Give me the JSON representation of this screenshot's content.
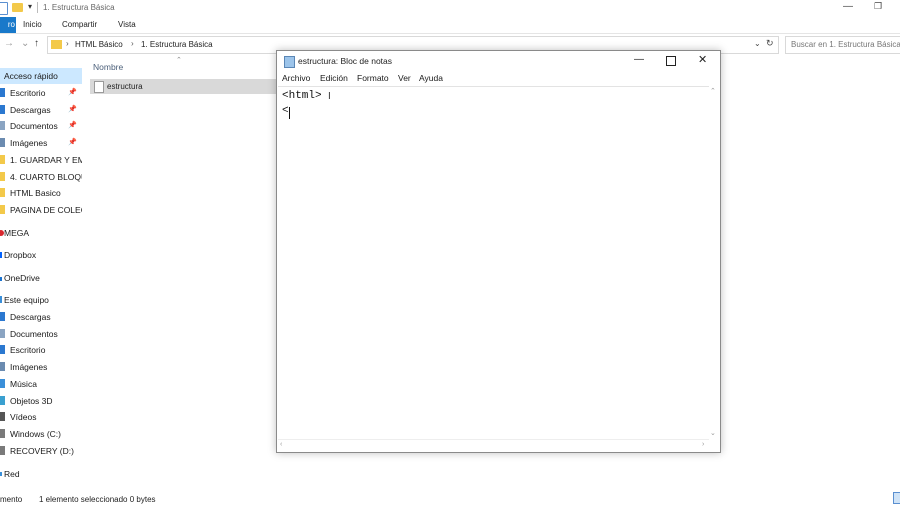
{
  "explorer": {
    "title": "1. Estructura Básica",
    "ribbon_tabs": [
      "ro",
      "Inicio",
      "Compartir",
      "Vista"
    ],
    "breadcrumb": [
      "HTML Básico",
      "1. Estructura Básica"
    ],
    "search_placeholder": "Buscar en 1. Estructura Básica",
    "column_name": "Nombre",
    "files": [
      "estructura"
    ],
    "status": {
      "items": "mento",
      "selected": "1 elemento seleccionado  0 bytes"
    }
  },
  "nav": {
    "quick_access": "Acceso rápido",
    "items": [
      {
        "label": "Escritorio",
        "icon": "desktop-icon",
        "color": "#2b78d0",
        "pinned": true
      },
      {
        "label": "Descargas",
        "icon": "download-icon",
        "color": "#2b78d0",
        "pinned": true
      },
      {
        "label": "Documentos",
        "icon": "documents-icon",
        "color": "#8aa4c2",
        "pinned": true
      },
      {
        "label": "Imágenes",
        "icon": "pictures-icon",
        "color": "#6b8bb0",
        "pinned": true
      },
      {
        "label": "1. GUARDAR Y EM",
        "icon": "folder-icon",
        "color": "#f3c94a",
        "pinned": false
      },
      {
        "label": "4. CUARTO BLOQU",
        "icon": "folder-icon",
        "color": "#f3c94a",
        "pinned": false
      },
      {
        "label": "HTML Basico",
        "icon": "folder-icon",
        "color": "#f3c94a",
        "pinned": false
      },
      {
        "label": "PAGINA DE COLEG",
        "icon": "folder-icon",
        "color": "#f3c94a",
        "pinned": false
      }
    ],
    "mega": "MEGA",
    "dropbox": "Dropbox",
    "onedrive": "OneDrive",
    "this_pc": "Este equipo",
    "pc_items": [
      {
        "label": "Descargas",
        "icon": "download-icon",
        "color": "#2b78d0"
      },
      {
        "label": "Documentos",
        "icon": "documents-icon",
        "color": "#8aa4c2"
      },
      {
        "label": "Escritorio",
        "icon": "desktop-icon",
        "color": "#2b78d0"
      },
      {
        "label": "Imágenes",
        "icon": "pictures-icon",
        "color": "#6b8bb0"
      },
      {
        "label": "Música",
        "icon": "music-icon",
        "color": "#3a8fd9"
      },
      {
        "label": "Objetos 3D",
        "icon": "objects-3d-icon",
        "color": "#3aa0d0"
      },
      {
        "label": "Vídeos",
        "icon": "videos-icon",
        "color": "#555555"
      },
      {
        "label": "Windows (C:)",
        "icon": "drive-icon",
        "color": "#7a7a7a"
      },
      {
        "label": "RECOVERY (D:)",
        "icon": "drive-icon",
        "color": "#7a7a7a"
      }
    ],
    "network": "Red"
  },
  "notepad": {
    "title": "estructura: Bloc de notas",
    "menu": [
      "Archivo",
      "Edición",
      "Formato",
      "Ver",
      "Ayuda"
    ],
    "content": "<html>\n<"
  },
  "colors": {
    "accent": "#1979ca",
    "selected_bg": "#cce8ff",
    "folder": "#f3c94a"
  }
}
